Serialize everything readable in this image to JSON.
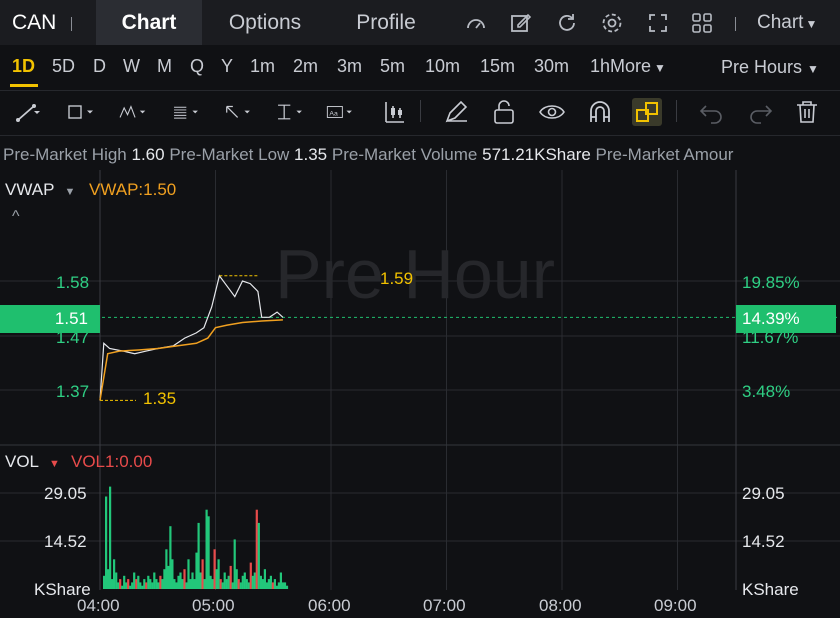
{
  "header": {
    "ticker": "CAN",
    "tabs": [
      {
        "label": "Chart"
      },
      {
        "label": "Options"
      },
      {
        "label": "Profile"
      }
    ],
    "chart_menu": "Chart"
  },
  "periods": [
    "1D",
    "5D",
    "D",
    "W",
    "M",
    "Q",
    "Y",
    "1m",
    "2m",
    "3m",
    "5m",
    "10m",
    "15m",
    "30m",
    "1h"
  ],
  "more_label": "More",
  "session_select": "Pre Hours",
  "info": {
    "high_label": "Pre-Market High",
    "high": "1.60",
    "low_label": "Pre-Market Low",
    "low": "1.35",
    "volume_label": "Pre-Market Volume",
    "volume": "571.21KShare",
    "amount_label": "Pre-Market Amour"
  },
  "indicator": {
    "name": "VWAP",
    "value_label": "VWAP:1.50",
    "color": "#f0a020"
  },
  "watermark": "Pre Hour",
  "price_axis_left": [
    "1.58",
    "1.47",
    "1.37"
  ],
  "price_axis_right": [
    "19.85%",
    "11.67%",
    "3.48%"
  ],
  "current_price": "1.51",
  "current_pct": "14.39%",
  "annot_high": "1.59",
  "annot_low": "1.35",
  "volume_panel": {
    "name": "VOL",
    "value_label": "VOL1:0.00",
    "axis_left": [
      "29.05",
      "14.52",
      "KShare"
    ],
    "axis_right": [
      "29.05",
      "14.52",
      "KShare"
    ]
  },
  "time_axis": [
    "04:00",
    "05:00",
    "06:00",
    "07:00",
    "08:00",
    "09:00"
  ],
  "colors": {
    "up": "#22c77a",
    "down": "#e84b4b",
    "accent": "#f2c200",
    "vwap": "#f0a020",
    "badge": "#1fbf6e"
  },
  "chart_data": {
    "type": "line",
    "x_range": [
      "04:00",
      "09:00"
    ],
    "series": [
      {
        "name": "",
        "values": [
          [
            0,
            1.35
          ],
          [
            2,
            1.46
          ],
          [
            5,
            1.45
          ],
          [
            12,
            1.445
          ],
          [
            18,
            1.44
          ],
          [
            24,
            1.445
          ],
          [
            30,
            1.45
          ],
          [
            38,
            1.455
          ],
          [
            44,
            1.47
          ],
          [
            50,
            1.48
          ],
          [
            54,
            1.49
          ],
          [
            58,
            1.53
          ],
          [
            62,
            1.59
          ],
          [
            66,
            1.57
          ],
          [
            70,
            1.55
          ],
          [
            74,
            1.58
          ],
          [
            78,
            1.575
          ],
          [
            82,
            1.56
          ],
          [
            84,
            1.51
          ],
          [
            88,
            1.51
          ],
          [
            92,
            1.52
          ],
          [
            95,
            1.51
          ]
        ]
      },
      {
        "name": "VWAP",
        "values": [
          [
            0,
            1.35
          ],
          [
            4,
            1.44
          ],
          [
            10,
            1.445
          ],
          [
            20,
            1.447
          ],
          [
            30,
            1.45
          ],
          [
            40,
            1.455
          ],
          [
            50,
            1.46
          ],
          [
            56,
            1.47
          ],
          [
            60,
            1.49
          ],
          [
            66,
            1.495
          ],
          [
            74,
            1.5
          ],
          [
            84,
            1.503
          ],
          [
            95,
            1.505
          ]
        ]
      }
    ],
    "y_ticks": [
      1.58,
      1.47,
      1.37
    ],
    "annotations": [
      {
        "label": "1.59",
        "x": 62,
        "y": 1.59
      },
      {
        "label": "1.35",
        "x": 0,
        "y": 1.35
      }
    ],
    "volume": {
      "type": "bar",
      "values": [
        4,
        28,
        6,
        31,
        3,
        9,
        5,
        2,
        3,
        1,
        4,
        2,
        3,
        1,
        2,
        5,
        3,
        4,
        2,
        1,
        3,
        2,
        4,
        3,
        2,
        5,
        3,
        2,
        4,
        3,
        6,
        12,
        7,
        19,
        9,
        3,
        2,
        4,
        5,
        3,
        6,
        2,
        9,
        3,
        5,
        3,
        11,
        20,
        5,
        9,
        3,
        24,
        22,
        4,
        3,
        12,
        6,
        9,
        3,
        2,
        5,
        3,
        4,
        7,
        2,
        15,
        6,
        3,
        2,
        4,
        5,
        3,
        2,
        8,
        4,
        5,
        24,
        20,
        4,
        3,
        6,
        2,
        3,
        4,
        2,
        3,
        1,
        2,
        5,
        2,
        2,
        1
      ],
      "colors": [
        "u",
        "u",
        "u",
        "u",
        "u",
        "u",
        "u",
        "u",
        "d",
        "u",
        "u",
        "u",
        "d",
        "u",
        "u",
        "u",
        "d",
        "u",
        "u",
        "u",
        "u",
        "d",
        "u",
        "u",
        "u",
        "u",
        "u",
        "u",
        "d",
        "u",
        "u",
        "u",
        "u",
        "u",
        "u",
        "u",
        "u",
        "u",
        "u",
        "u",
        "d",
        "u",
        "u",
        "u",
        "u",
        "u",
        "u",
        "u",
        "u",
        "d",
        "u",
        "u",
        "u",
        "u",
        "u",
        "d",
        "u",
        "u",
        "d",
        "u",
        "u",
        "u",
        "u",
        "d",
        "u",
        "u",
        "u",
        "d",
        "u",
        "u",
        "u",
        "u",
        "u",
        "d",
        "u",
        "u",
        "d",
        "u",
        "u",
        "u",
        "u",
        "u",
        "u",
        "u",
        "d",
        "u",
        "u",
        "u",
        "u",
        "u",
        "u",
        "u"
      ],
      "y_ticks": [
        29.05,
        14.52
      ]
    }
  }
}
